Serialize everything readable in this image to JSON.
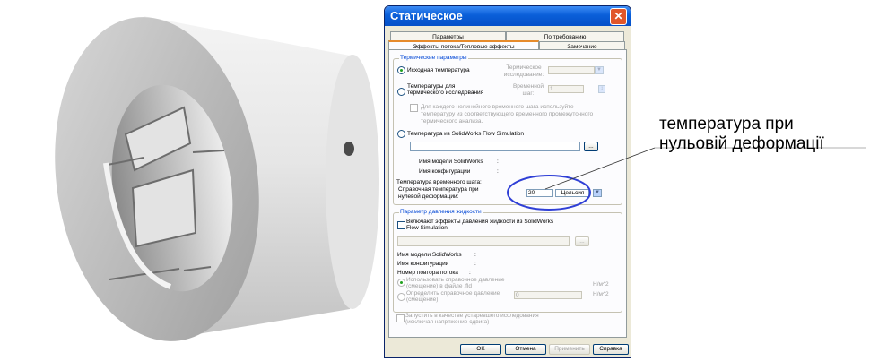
{
  "dialog": {
    "title": "Статическое",
    "tabs_top": [
      "Параметры",
      "По требованию"
    ],
    "tabs_bottom": [
      "Эффекты потока/Тепловые эффекты",
      "Замечание"
    ],
    "thermal": {
      "caption": "Термические параметры",
      "opt_initial": "Исходная температура",
      "thermal_study_label": "Термическое исследование:",
      "opt_from_thermal_line1": "Температуры для",
      "opt_from_thermal_line2": "термического исследования",
      "time_step_label": "Временной шаг:",
      "time_step_value": "1",
      "each_step_line1": "Для каждого нелинейного временного шага используйте",
      "each_step_line2": "температуру из соответствующего временного промежуточного",
      "each_step_line3": "термического анализа.",
      "opt_flow_sim": "Температура из SolidWorks Flow Simulation",
      "browse": "...",
      "model_name": "Имя модели SolidWorks",
      "config_name": "Имя конфигурации",
      "colon": ":",
      "time_step_temp": "Температура временного шага:",
      "ref_temp_line1": "Справочная температура при",
      "ref_temp_line2": "нулевой деформации:",
      "ref_temp_value": "20",
      "ref_temp_unit": "Цельсия"
    },
    "fluid": {
      "caption": "Параметр давления жидкости",
      "include_line1": "Включают эффекты давления жидкости из SolidWorks",
      "include_line2": "Flow Simulation",
      "browse": "...",
      "model_name": "Имя модели SolidWorks",
      "config_name": "Имя конфигурации",
      "step_number": "Номер повтора потока",
      "colon": ":",
      "use_ref_line1": "Использовать справочное давление",
      "use_ref_line2": "(смещение) в файле .fld",
      "unit1": "Н/м^2",
      "define_ref_line1": "Определить справочное давление",
      "define_ref_line2": "(смещение)",
      "define_ref_value": "0",
      "unit2": "Н/м^2",
      "run_as_line1": "Запустить в качестве устаревшего исследования",
      "run_as_line2": "(исключая напряжение сдвига)"
    },
    "buttons": {
      "ok": "OK",
      "cancel": "Отмена",
      "apply": "Применить",
      "help": "Справка"
    }
  },
  "annotation": {
    "line1": "температура при",
    "line2": "нульовій деформації"
  },
  "colors": {
    "title_bar": "#0a5fd9",
    "dialog_bg": "#ece9d8",
    "highlight_ellipse": "#2f3fd6",
    "part_gray": "#d4d4d4"
  },
  "icons": {
    "close": "close-icon",
    "dropdown": "chevron-down-icon"
  }
}
